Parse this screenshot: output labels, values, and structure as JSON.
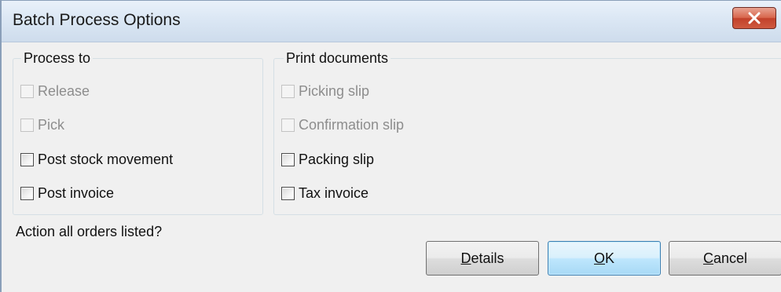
{
  "window": {
    "title": "Batch Process Options",
    "close_icon": "close-icon"
  },
  "process_to": {
    "legend": "Process to",
    "items": [
      {
        "label": "Release",
        "checked": false,
        "enabled": false
      },
      {
        "label": "Pick",
        "checked": false,
        "enabled": false
      },
      {
        "label": "Post stock movement",
        "checked": false,
        "enabled": true
      },
      {
        "label": "Post invoice",
        "checked": false,
        "enabled": true
      }
    ]
  },
  "print_documents": {
    "legend": "Print documents",
    "items": [
      {
        "label": "Picking slip",
        "checked": false,
        "enabled": false
      },
      {
        "label": "Confirmation slip",
        "checked": false,
        "enabled": false
      },
      {
        "label": "Packing slip",
        "checked": false,
        "enabled": true
      },
      {
        "label": "Tax invoice",
        "checked": false,
        "enabled": true
      }
    ]
  },
  "prompt": "Action all orders listed?",
  "buttons": {
    "details": {
      "mnemonic": "D",
      "rest": "etails"
    },
    "ok": {
      "mnemonic": "O",
      "rest": "K"
    },
    "cancel": {
      "mnemonic": "C",
      "rest": "ancel"
    }
  },
  "colors": {
    "window_background": "#f0f0f0",
    "close_button": "#c2412a",
    "default_button_border": "#3c7fb1",
    "disabled_text": "#8d8d8d"
  }
}
